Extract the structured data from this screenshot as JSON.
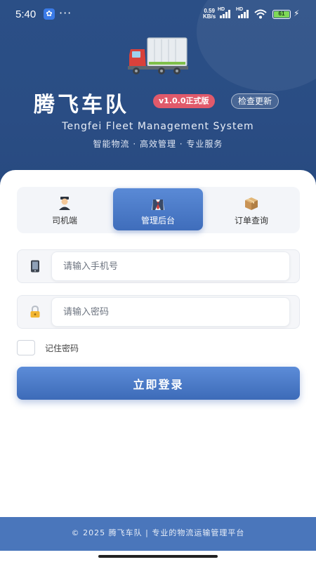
{
  "status_bar": {
    "time": "5:40",
    "app_icon": "baidu-paw-icon",
    "more": "···",
    "net_speed_value": "0.59",
    "net_speed_unit": "KB/s",
    "sim1_label": "HD",
    "sim2_label": "HD",
    "battery": "61"
  },
  "header": {
    "app_title": "腾飞车队",
    "version_badge": "v1.0.0正式版",
    "check_update_label": "检查更新",
    "subtitle": "Tengfei Fleet Management System",
    "tagline": "智能物流 · 高效管理 · 专业服务",
    "logo_icon": "truck-icon"
  },
  "tabs": [
    {
      "label": "司机端",
      "icon": "driver-icon",
      "active": false
    },
    {
      "label": "管理后台",
      "icon": "manager-icon",
      "active": true
    },
    {
      "label": "订单查询",
      "icon": "package-icon",
      "active": false
    }
  ],
  "form": {
    "phone_placeholder": "请输入手机号",
    "phone_icon": "phone-icon",
    "password_placeholder": "请输入密码",
    "password_icon": "lock-icon",
    "remember_label": "记住密码",
    "login_label": "立即登录"
  },
  "footer": {
    "text": "© 2025 腾飞车队 | 专业的物流运输管理平台"
  },
  "colors": {
    "header_bg": "#2b4f86",
    "accent": "#4a78c5",
    "version_badge": "#e15a6b",
    "footer_bg": "#4a76bb"
  }
}
